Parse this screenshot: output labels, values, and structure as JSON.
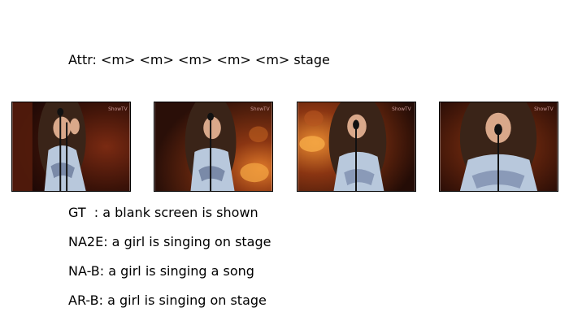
{
  "attr": {
    "text": "Attr: <m> <m> <m> <m> <m> stage"
  },
  "frames": [
    {
      "watermark": "ShowTV"
    },
    {
      "watermark": "ShowTV"
    },
    {
      "watermark": "ShowTV"
    },
    {
      "watermark": "ShowTV"
    }
  ],
  "captions": {
    "gt": "GT  : a blank screen is shown",
    "na2e": "NA2E: a girl is singing on stage",
    "nab": "NA-B: a girl is singing a song",
    "arb": "AR-B: a girl is singing on stage"
  },
  "colors": {
    "stage_dark": "#2a0f08",
    "stage_orange": "#e07a2a",
    "hair": "#3a2418",
    "dress": "#b8c8dc",
    "skin": "#d9a88a"
  }
}
